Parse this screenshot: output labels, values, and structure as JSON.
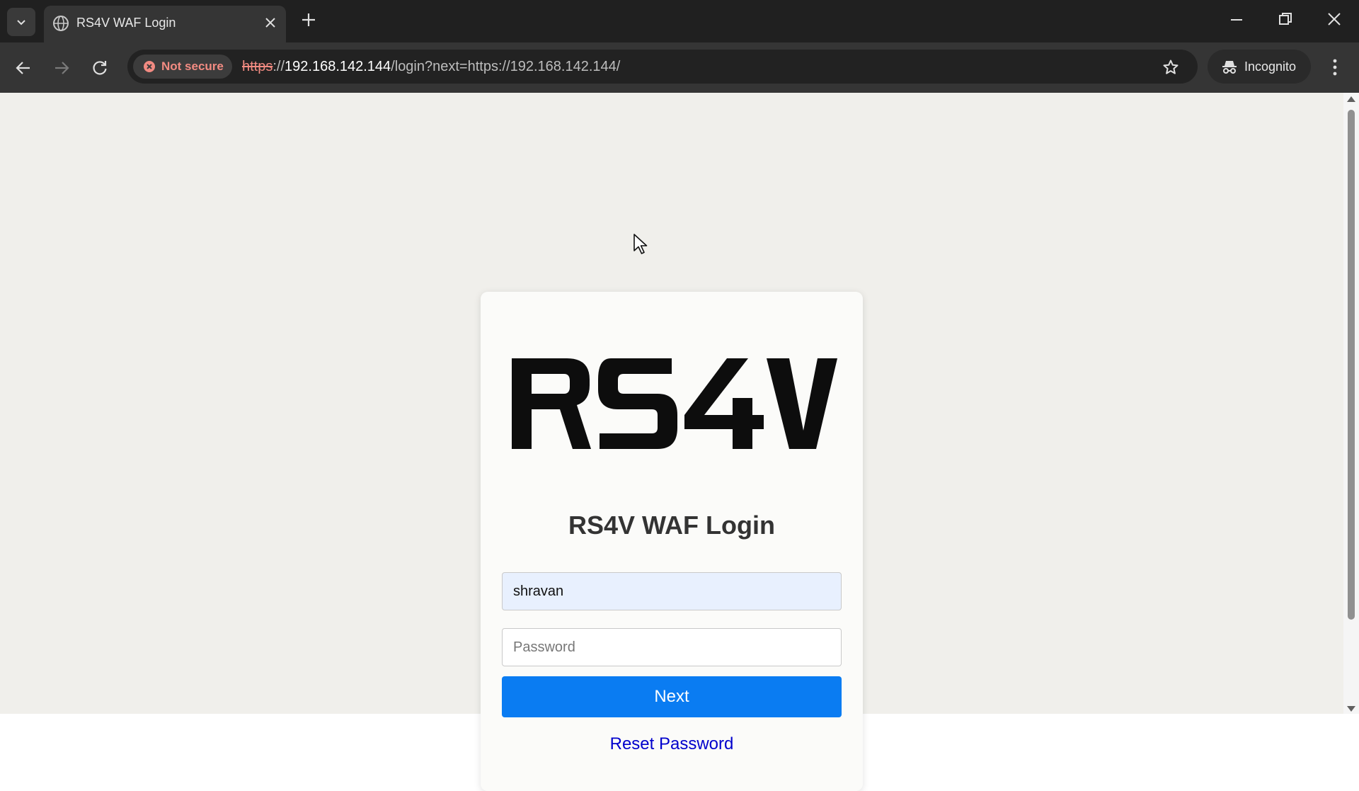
{
  "browser": {
    "tab": {
      "title": "RS4V WAF Login",
      "favicon": "globe-icon"
    },
    "security": {
      "label": "Not secure",
      "icon": "error-circle-icon"
    },
    "address": {
      "scheme": "https",
      "rest": "://",
      "host": "192.168.142.144",
      "path": "/login?next=https://192.168.142.144/"
    },
    "incognito_label": "Incognito",
    "colors": {
      "frame": "#202020",
      "toolbar": "#353535",
      "warning": "#f28b82"
    }
  },
  "page": {
    "logo_text": "RS4V",
    "title": "RS4V WAF Login",
    "username": {
      "value": "shravan"
    },
    "password": {
      "placeholder": "Password"
    },
    "next_label": "Next",
    "reset_label": "Reset Password",
    "colors": {
      "background": "#f0efeb",
      "button": "#0a7cf2",
      "link": "#0000cc"
    }
  }
}
